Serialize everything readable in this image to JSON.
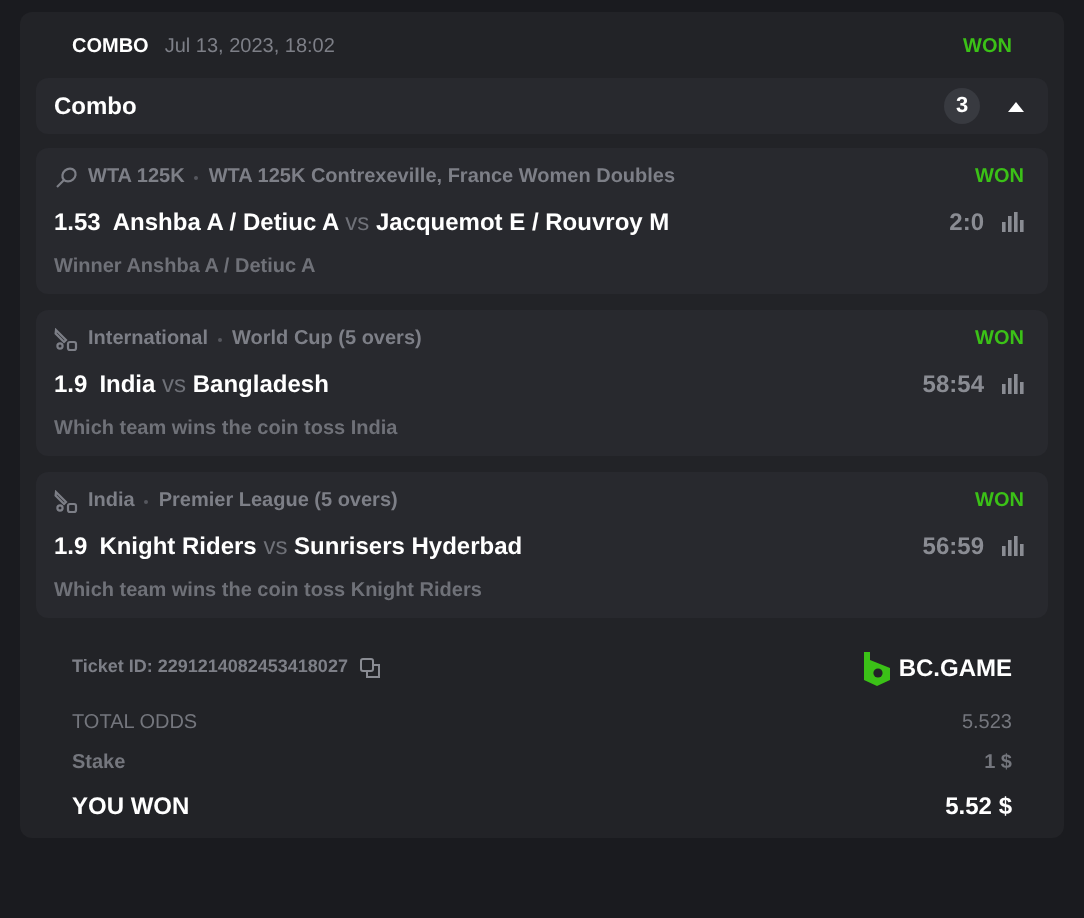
{
  "header": {
    "type": "COMBO",
    "date": "Jul 13, 2023, 18:02",
    "status": "WON"
  },
  "combo": {
    "title": "Combo",
    "count": "3",
    "expanded": true
  },
  "selections": [
    {
      "kind": "tennis",
      "category": "WTA 125K",
      "league": "WTA 125K Contrexeville, France Women Doubles",
      "status": "WON",
      "odds": "1.53",
      "home": "Anshba A / Detiuc A",
      "vs": "vs",
      "away": "Jacquemot E / Rouvroy M",
      "score": "2:0",
      "market": "Winner Anshba A / Detiuc A"
    },
    {
      "kind": "cricket",
      "category": "International",
      "league": "World Cup (5 overs)",
      "status": "WON",
      "odds": "1.9",
      "home": "India",
      "vs": "vs",
      "away": "Bangladesh",
      "score": "58:54",
      "market": "Which team wins the coin toss India"
    },
    {
      "kind": "cricket",
      "category": "India",
      "league": "Premier League (5 overs)",
      "status": "WON",
      "odds": "1.9",
      "home": "Knight Riders",
      "vs": "vs",
      "away": "Sunrisers Hyderbad",
      "score": "56:59",
      "market": "Which team wins the coin toss Knight Riders"
    }
  ],
  "ticket": {
    "label": "Ticket ID: 2291214082453418027",
    "brand": "BC.GAME"
  },
  "summary": [
    {
      "kind": "muted",
      "label": "TOTAL ODDS",
      "value": "5.523"
    },
    {
      "kind": "bold",
      "label": "Stake",
      "value": "1 $"
    },
    {
      "kind": "total",
      "label": "YOU WON",
      "value": "5.52 $"
    }
  ]
}
